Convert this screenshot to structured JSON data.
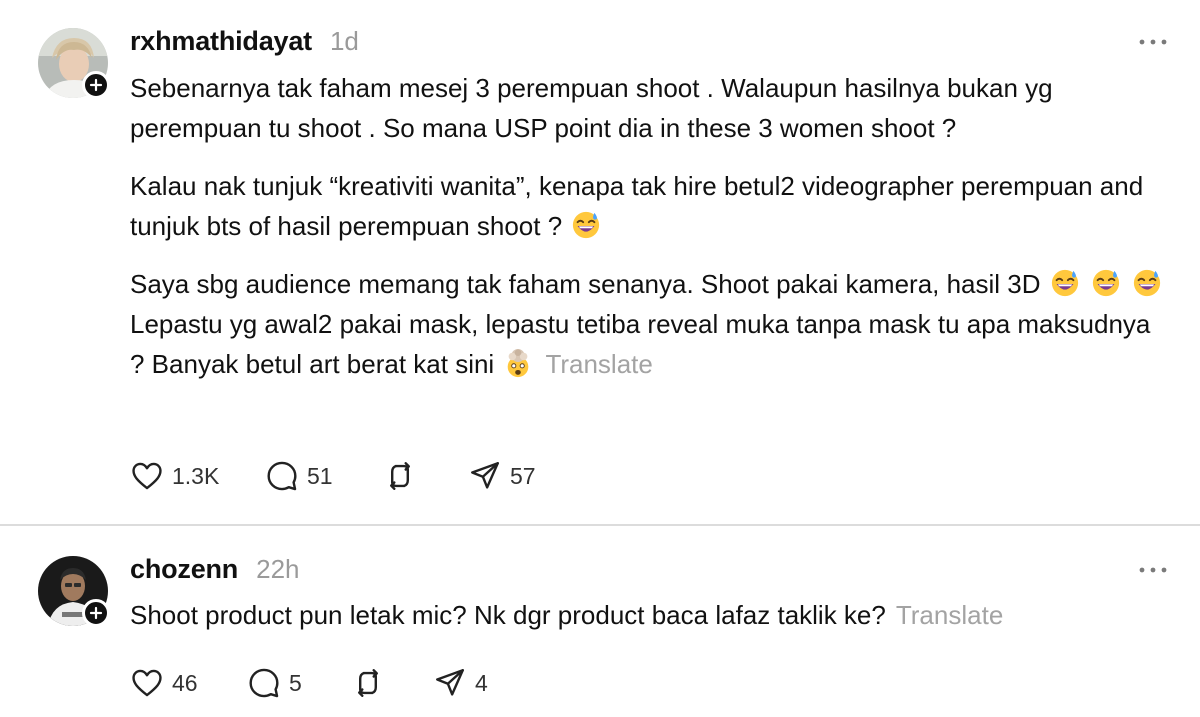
{
  "posts": [
    {
      "username": "rxhmathidayat",
      "time": "1d",
      "paragraphs": {
        "p1": "Sebenarnya tak faham mesej 3 perempuan shoot . Walaupun hasilnya bukan yg perempuan tu shoot . So mana USP point dia in these 3 women shoot ?",
        "p2": "Kalau nak tunjuk “kreativiti wanita”, kenapa tak hire betul2 videographer perempuan and tunjuk bts of hasil perempuan shoot ?",
        "p3": "Saya sbg audience memang tak faham senanya. Shoot pakai kamera, hasil 3D",
        "p4": "Lepastu yg awal2 pakai mask, lepastu tetiba reveal muka tanpa mask tu apa maksudnya ? Banyak betul art berat kat sini"
      },
      "emojis": [
        "grinning-sweat-emoji",
        "grinning-sweat-emoji",
        "grinning-sweat-emoji",
        "grinning-sweat-emoji",
        "exploding-head-emoji"
      ],
      "translate": "Translate",
      "stats": {
        "likes": "1.3K",
        "replies": "51",
        "shares": "57"
      }
    },
    {
      "username": "chozenn",
      "time": "22h",
      "paragraphs": {
        "p1": "Shoot product pun letak mic? Nk dgr product baca lafaz taklik ke?"
      },
      "translate": "Translate",
      "stats": {
        "likes": "46",
        "replies": "5",
        "shares": "4"
      }
    }
  ],
  "icons": {
    "like": "heart-icon",
    "reply": "comment-bubble-icon",
    "repost": "repost-icon",
    "share": "send-icon",
    "more": "more-dots-icon",
    "follow": "plus-icon"
  },
  "colors": {
    "text": "#111111",
    "muted": "#9a9a9a",
    "translate": "#a3a3a3",
    "divider": "#dcdcdc",
    "emoji_face": "#ffc83d"
  }
}
